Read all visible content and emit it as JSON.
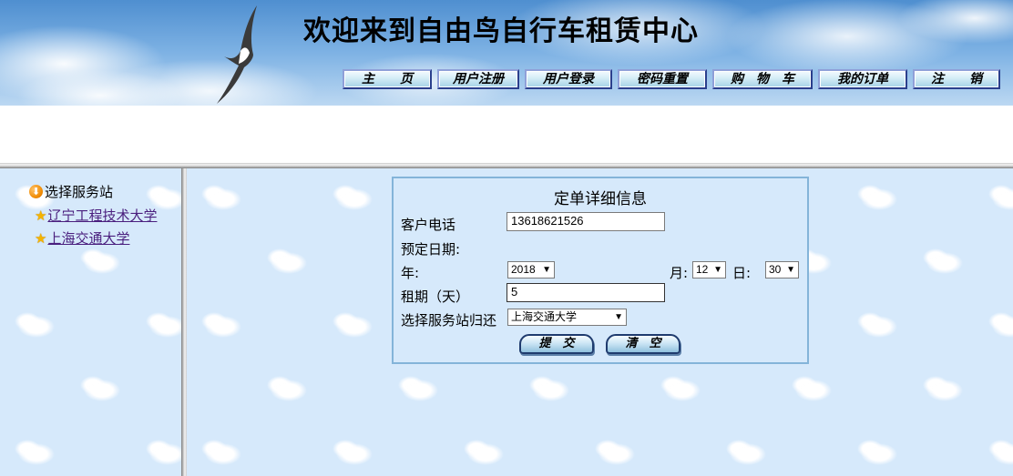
{
  "header": {
    "title": "欢迎来到自由鸟自行车租赁中心",
    "nav": [
      "主　　页",
      "用户注册",
      "用户登录",
      "密码重置",
      "购　物　车",
      "我的订单",
      "注　　销"
    ]
  },
  "sidebar": {
    "title": "选择服务站",
    "stations": [
      "辽宁工程技术大学",
      "上海交通大学"
    ]
  },
  "form": {
    "title": "定单详细信息",
    "phone_label": "客户电话",
    "phone_value": "13618621526",
    "date_label": "预定日期:",
    "year_label": "年:",
    "year_value": "2018",
    "month_label": "月:",
    "month_value": "12",
    "day_label": "日:",
    "day_value": "30",
    "period_label": "租期（天）",
    "period_value": "5",
    "return_label": "选择服务站归还",
    "return_value": "上海交通大学",
    "submit_label": "提　交",
    "clear_label": "清　空"
  }
}
